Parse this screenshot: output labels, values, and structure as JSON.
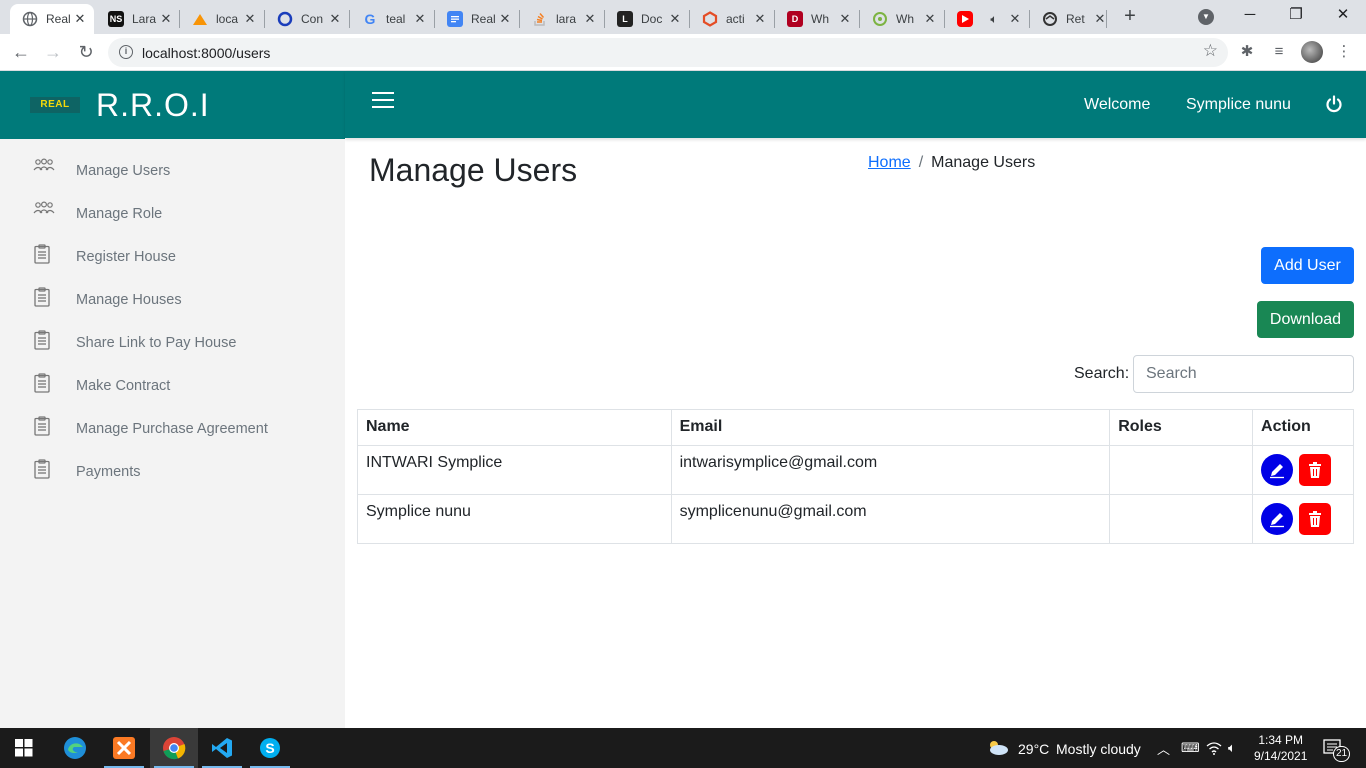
{
  "browser": {
    "tabs": [
      {
        "title": "Real",
        "favicon": "globe-icon",
        "color": "#5f6368",
        "active": true
      },
      {
        "title": "Lara",
        "favicon": "ns-icon",
        "color": "#111111"
      },
      {
        "title": "loca",
        "favicon": "pma-icon",
        "color": "#f89406"
      },
      {
        "title": "Con",
        "favicon": "circle-icon",
        "color": "#1a3dbb"
      },
      {
        "title": "teal",
        "favicon": "google-icon",
        "color": "#4285f4"
      },
      {
        "title": "Real",
        "favicon": "docs-icon",
        "color": "#4285f4"
      },
      {
        "title": "lara",
        "favicon": "stackoverflow-icon",
        "color": "#f48024"
      },
      {
        "title": "Doc",
        "favicon": "laravel-icon",
        "color": "#222222"
      },
      {
        "title": "acti",
        "favicon": "hexagon-icon",
        "color": "#e44d26"
      },
      {
        "title": "Wh",
        "favicon": "d-icon",
        "color": "#b00020"
      },
      {
        "title": "Wh",
        "favicon": "whatsapp-icon",
        "color": "#7cb342"
      },
      {
        "title": "",
        "favicon": "youtube-icon",
        "color": "#ff0000",
        "audio": true
      },
      {
        "title": "Ret",
        "favicon": "refresh-icon",
        "color": "#333333"
      }
    ],
    "url": "localhost:8000/users"
  },
  "app": {
    "brand": "R.R.O.I",
    "logo_text": "REAL",
    "welcome": "Welcome",
    "username": "Symplice nunu"
  },
  "sidebar": {
    "items": [
      {
        "label": "Manage Users",
        "icon": "users-icon"
      },
      {
        "label": "Manage Role",
        "icon": "users-icon"
      },
      {
        "label": "Register House",
        "icon": "clipboard-icon"
      },
      {
        "label": "Manage Houses",
        "icon": "clipboard-icon"
      },
      {
        "label": "Share Link to Pay House",
        "icon": "clipboard-icon"
      },
      {
        "label": "Make Contract",
        "icon": "clipboard-icon"
      },
      {
        "label": "Manage Purchase Agreement",
        "icon": "clipboard-icon"
      },
      {
        "label": "Payments",
        "icon": "clipboard-icon"
      }
    ]
  },
  "main": {
    "title": "Manage Users",
    "breadcrumb": {
      "home": "Home",
      "separator": "/",
      "current": "Manage Users"
    },
    "add_button": "Add User",
    "download_button": "Download",
    "search": {
      "label": "Search:",
      "placeholder": "Search",
      "value": ""
    },
    "table": {
      "columns": [
        "Name",
        "Email",
        "Roles",
        "Action"
      ],
      "rows": [
        {
          "name": "INTWARI Symplice",
          "email": "intwarisymplice@gmail.com",
          "roles": ""
        },
        {
          "name": "Symplice nunu",
          "email": "symplicenunu@gmail.com",
          "roles": ""
        }
      ]
    }
  },
  "taskbar": {
    "weather": {
      "temp": "29°C",
      "condition": "Mostly cloudy"
    },
    "time": "1:34 PM",
    "date": "9/14/2021",
    "notifications": "21"
  },
  "colors": {
    "header": "#007a7a",
    "sidebar_bg": "#f3f3f3",
    "primary": "#0d6efd",
    "success": "#198754",
    "edit": "#0000e6",
    "delete": "#ff0000"
  }
}
